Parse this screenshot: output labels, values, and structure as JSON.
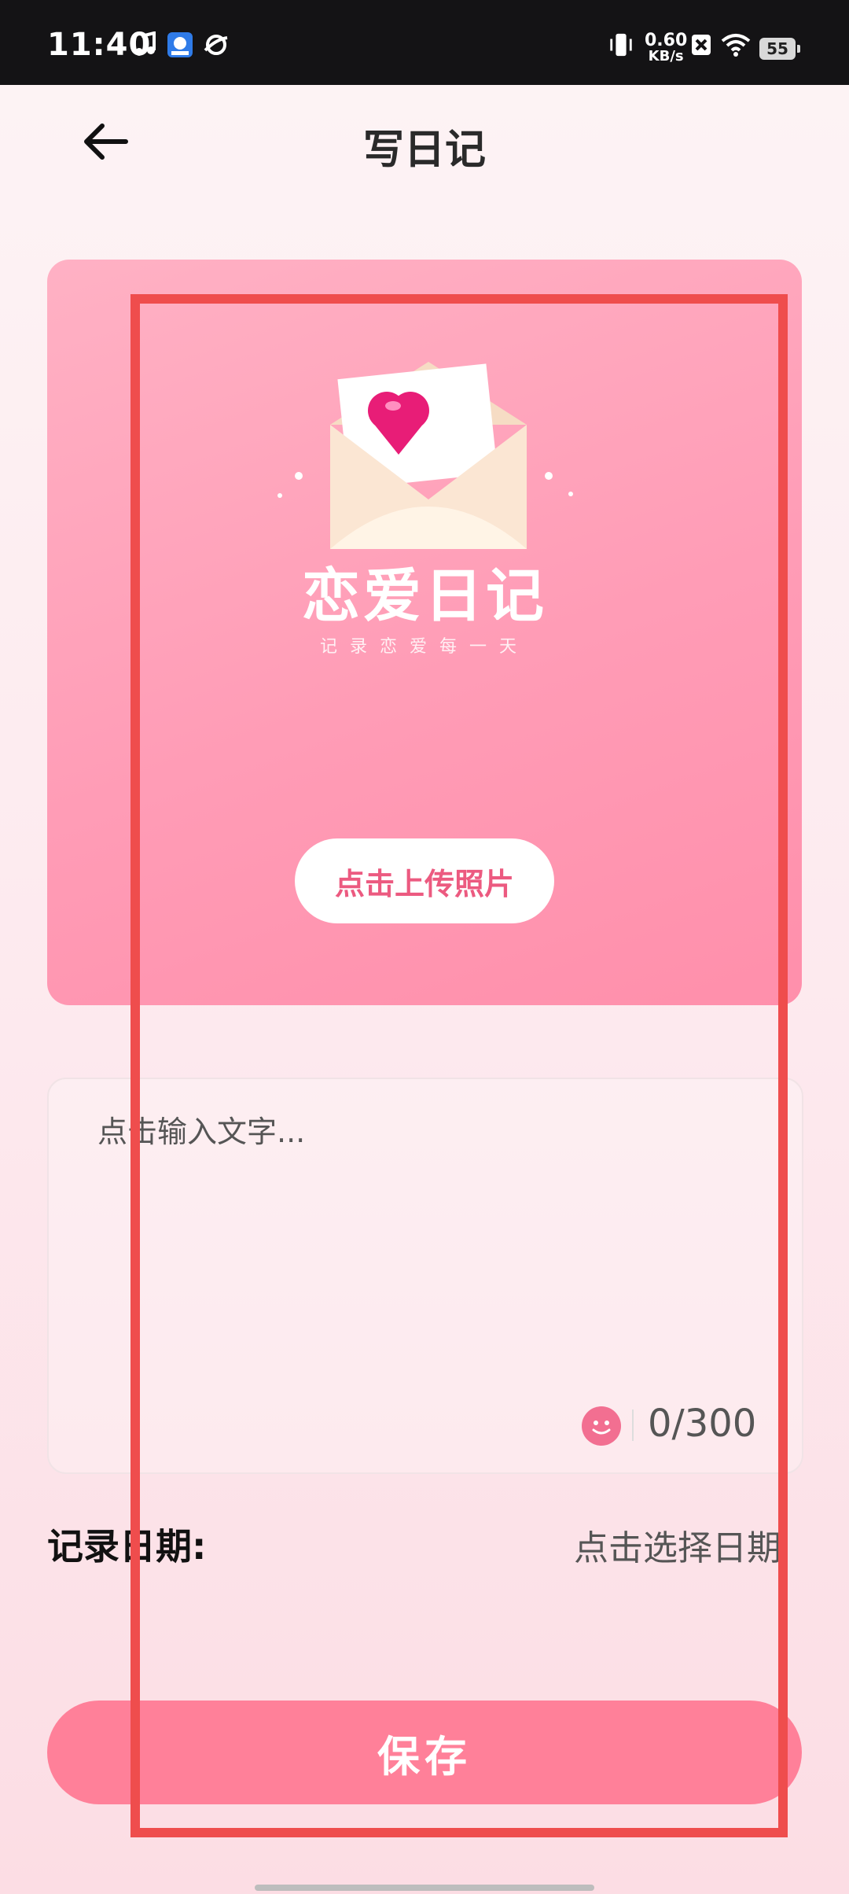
{
  "status_bar": {
    "time": "11:40",
    "net_speed_value": "0.60",
    "net_speed_unit": "KB/s",
    "battery": "55"
  },
  "header": {
    "title": "写日记"
  },
  "photo_card": {
    "brand_title": "恋爱日记",
    "brand_subtitle": "记录恋爱每一天",
    "upload_label": "点击上传照片"
  },
  "editor": {
    "placeholder": "点击输入文字...",
    "value": "",
    "counter": "0/300"
  },
  "date": {
    "label": "记录日期:",
    "placeholder": "点击选择日期"
  },
  "save_label": "保存",
  "colors": {
    "accent": "#ff8099",
    "card_pink": "#ff9cb6",
    "upload_text": "#ec5a80",
    "highlight": "#ef4d4d"
  }
}
